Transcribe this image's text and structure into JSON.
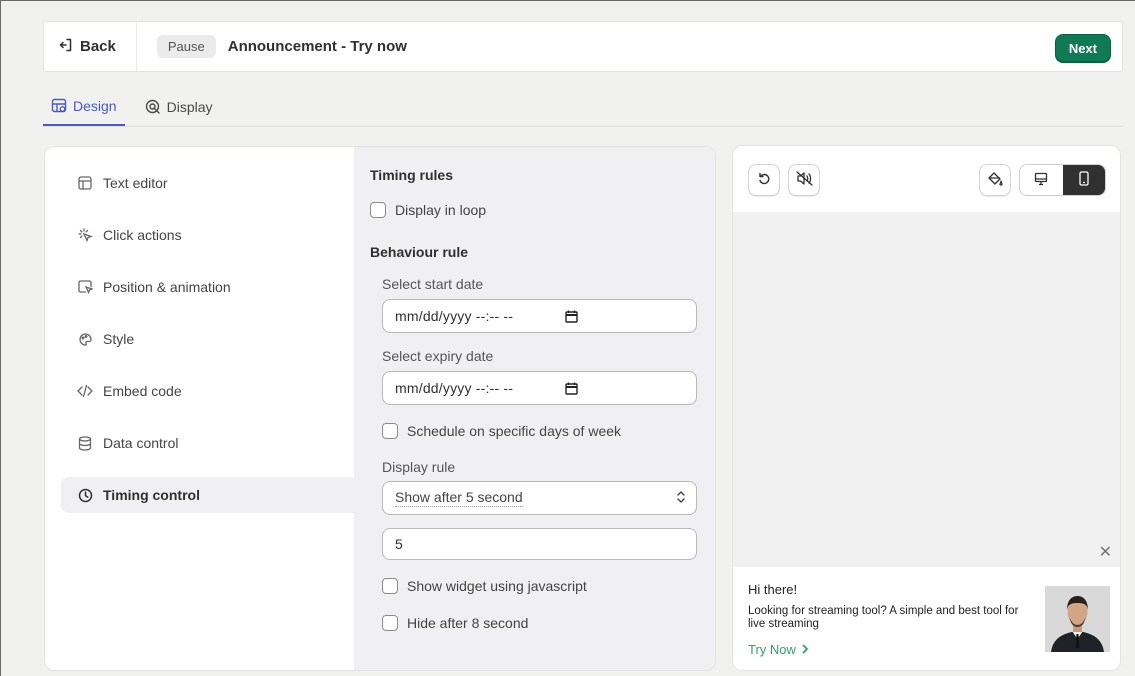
{
  "header": {
    "back_label": "Back",
    "status_badge": "Pause",
    "title": "Announcement - Try now",
    "next_label": "Next"
  },
  "tabs": [
    {
      "label": "Design",
      "icon": "design-icon",
      "active": true
    },
    {
      "label": "Display",
      "icon": "display-icon",
      "active": false
    }
  ],
  "menu": {
    "items": [
      {
        "label": "Text editor",
        "icon": "text-editor-icon"
      },
      {
        "label": "Click actions",
        "icon": "click-actions-icon"
      },
      {
        "label": "Position & animation",
        "icon": "position-icon"
      },
      {
        "label": "Style",
        "icon": "style-icon"
      },
      {
        "label": "Embed code",
        "icon": "code-icon"
      },
      {
        "label": "Data control",
        "icon": "database-icon"
      },
      {
        "label": "Timing control",
        "icon": "clock-icon",
        "active": true
      }
    ]
  },
  "timing": {
    "timing_rules_title": "Timing rules",
    "display_in_loop_label": "Display in loop",
    "behaviour_rule_title": "Behaviour rule",
    "start_date_label": "Select start date",
    "start_date_value": "mm/dd/yyyy --:-- --",
    "expiry_date_label": "Select expiry date",
    "expiry_date_value": "mm/dd/yyyy --:-- --",
    "schedule_days_label": "Schedule on specific days of week",
    "display_rule_label": "Display rule",
    "display_rule_selected": "Show after 5 second",
    "seconds_value": "5",
    "show_widget_js_label": "Show widget using javascript",
    "hide_after_label": "Hide after 8 second"
  },
  "preview": {
    "tools": [
      "undo-icon",
      "mute-icon",
      "paint-icon"
    ],
    "devices": [
      {
        "name": "desktop-icon",
        "active": false
      },
      {
        "name": "mobile-icon",
        "active": true
      }
    ],
    "close_symbol": "✕",
    "widget": {
      "title": "Hi there!",
      "body": "Looking for streaming tool? A simple and best tool for live streaming",
      "cta": "Try Now"
    }
  },
  "colors": {
    "accent": "#4a5bbd",
    "primary_button": "#107a55",
    "cta_green": "#2ea36a",
    "panel_bg": "#f0f0f2"
  }
}
